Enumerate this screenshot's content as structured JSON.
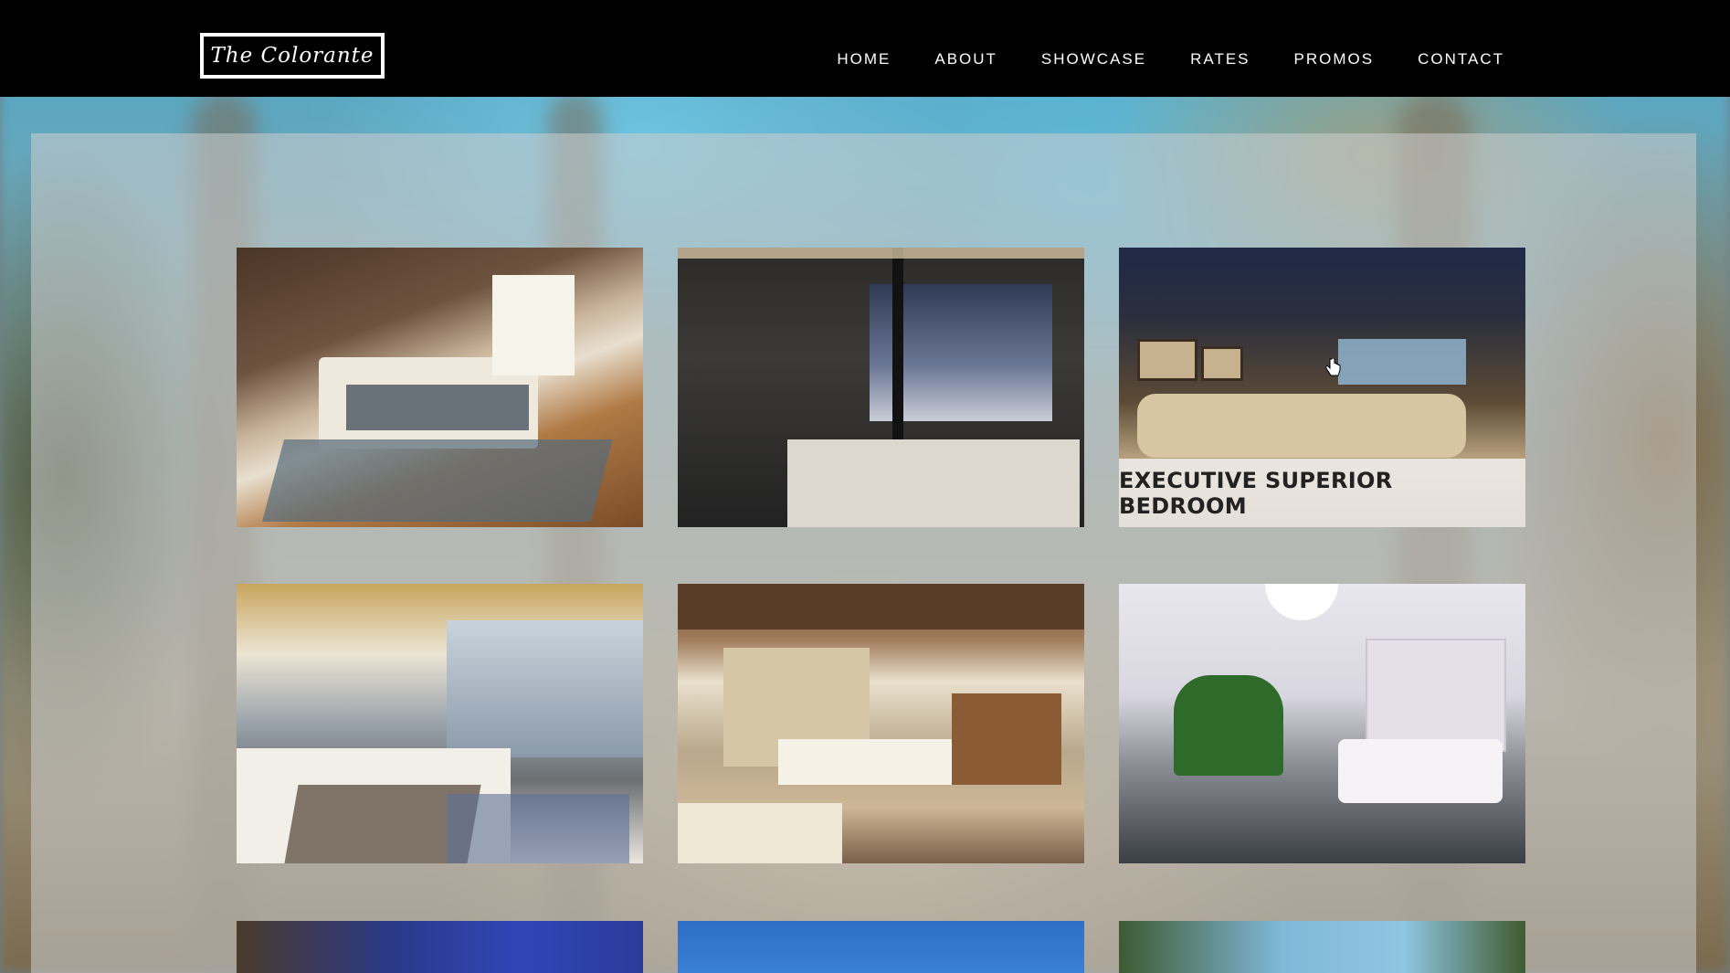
{
  "brand": {
    "name": "The Colorante"
  },
  "nav": {
    "items": [
      {
        "label": "HOME"
      },
      {
        "label": "ABOUT"
      },
      {
        "label": "SHOWCASE"
      },
      {
        "label": "RATES"
      },
      {
        "label": "PROMOS"
      },
      {
        "label": "CONTACT"
      }
    ]
  },
  "gallery": {
    "tiles": [
      {
        "caption": ""
      },
      {
        "caption": ""
      },
      {
        "caption": "EXECUTIVE SUPERIOR BEDROOM"
      },
      {
        "caption": ""
      },
      {
        "caption": ""
      },
      {
        "caption": ""
      },
      {
        "caption": ""
      },
      {
        "caption": ""
      },
      {
        "caption": ""
      }
    ]
  }
}
